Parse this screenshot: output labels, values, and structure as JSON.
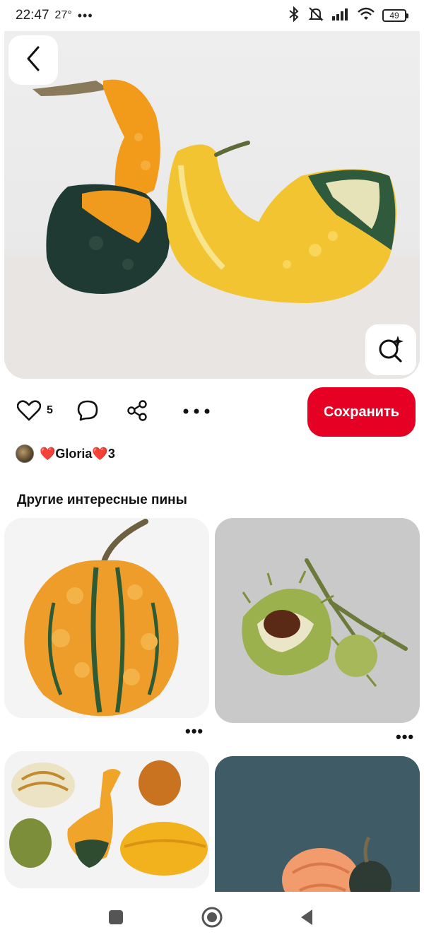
{
  "status_bar": {
    "time": "22:47",
    "temperature": "27°",
    "overflow": "•••",
    "battery": "49",
    "icons": [
      "bluetooth-icon",
      "mute-icon",
      "signal-icon",
      "wifi-icon",
      "battery-icon"
    ]
  },
  "pin": {
    "image": "two-ornamental-gourds-photo",
    "like_count": "5",
    "save_label": "Сохранить",
    "author": "❤️Gloria❤️3",
    "icons": [
      "back-icon",
      "visual-search-icon",
      "heart-icon",
      "comment-icon",
      "share-icon",
      "more-icon"
    ]
  },
  "more_ideas": {
    "title": "Другие интересные пины",
    "items": [
      {
        "image": "warty-orange-gourd",
        "more": "•••"
      },
      {
        "image": "chestnut-in-spiky-husk",
        "more": "•••"
      },
      {
        "image": "assorted-small-pumpkins"
      },
      {
        "image": "pumpkins-on-blue-background"
      }
    ]
  },
  "colors": {
    "accent": "#e60023",
    "text": "#111111",
    "background": "#ffffff"
  },
  "nav_bar": {
    "icons": [
      "recent-apps-icon",
      "home-icon",
      "back-triangle-icon"
    ]
  }
}
